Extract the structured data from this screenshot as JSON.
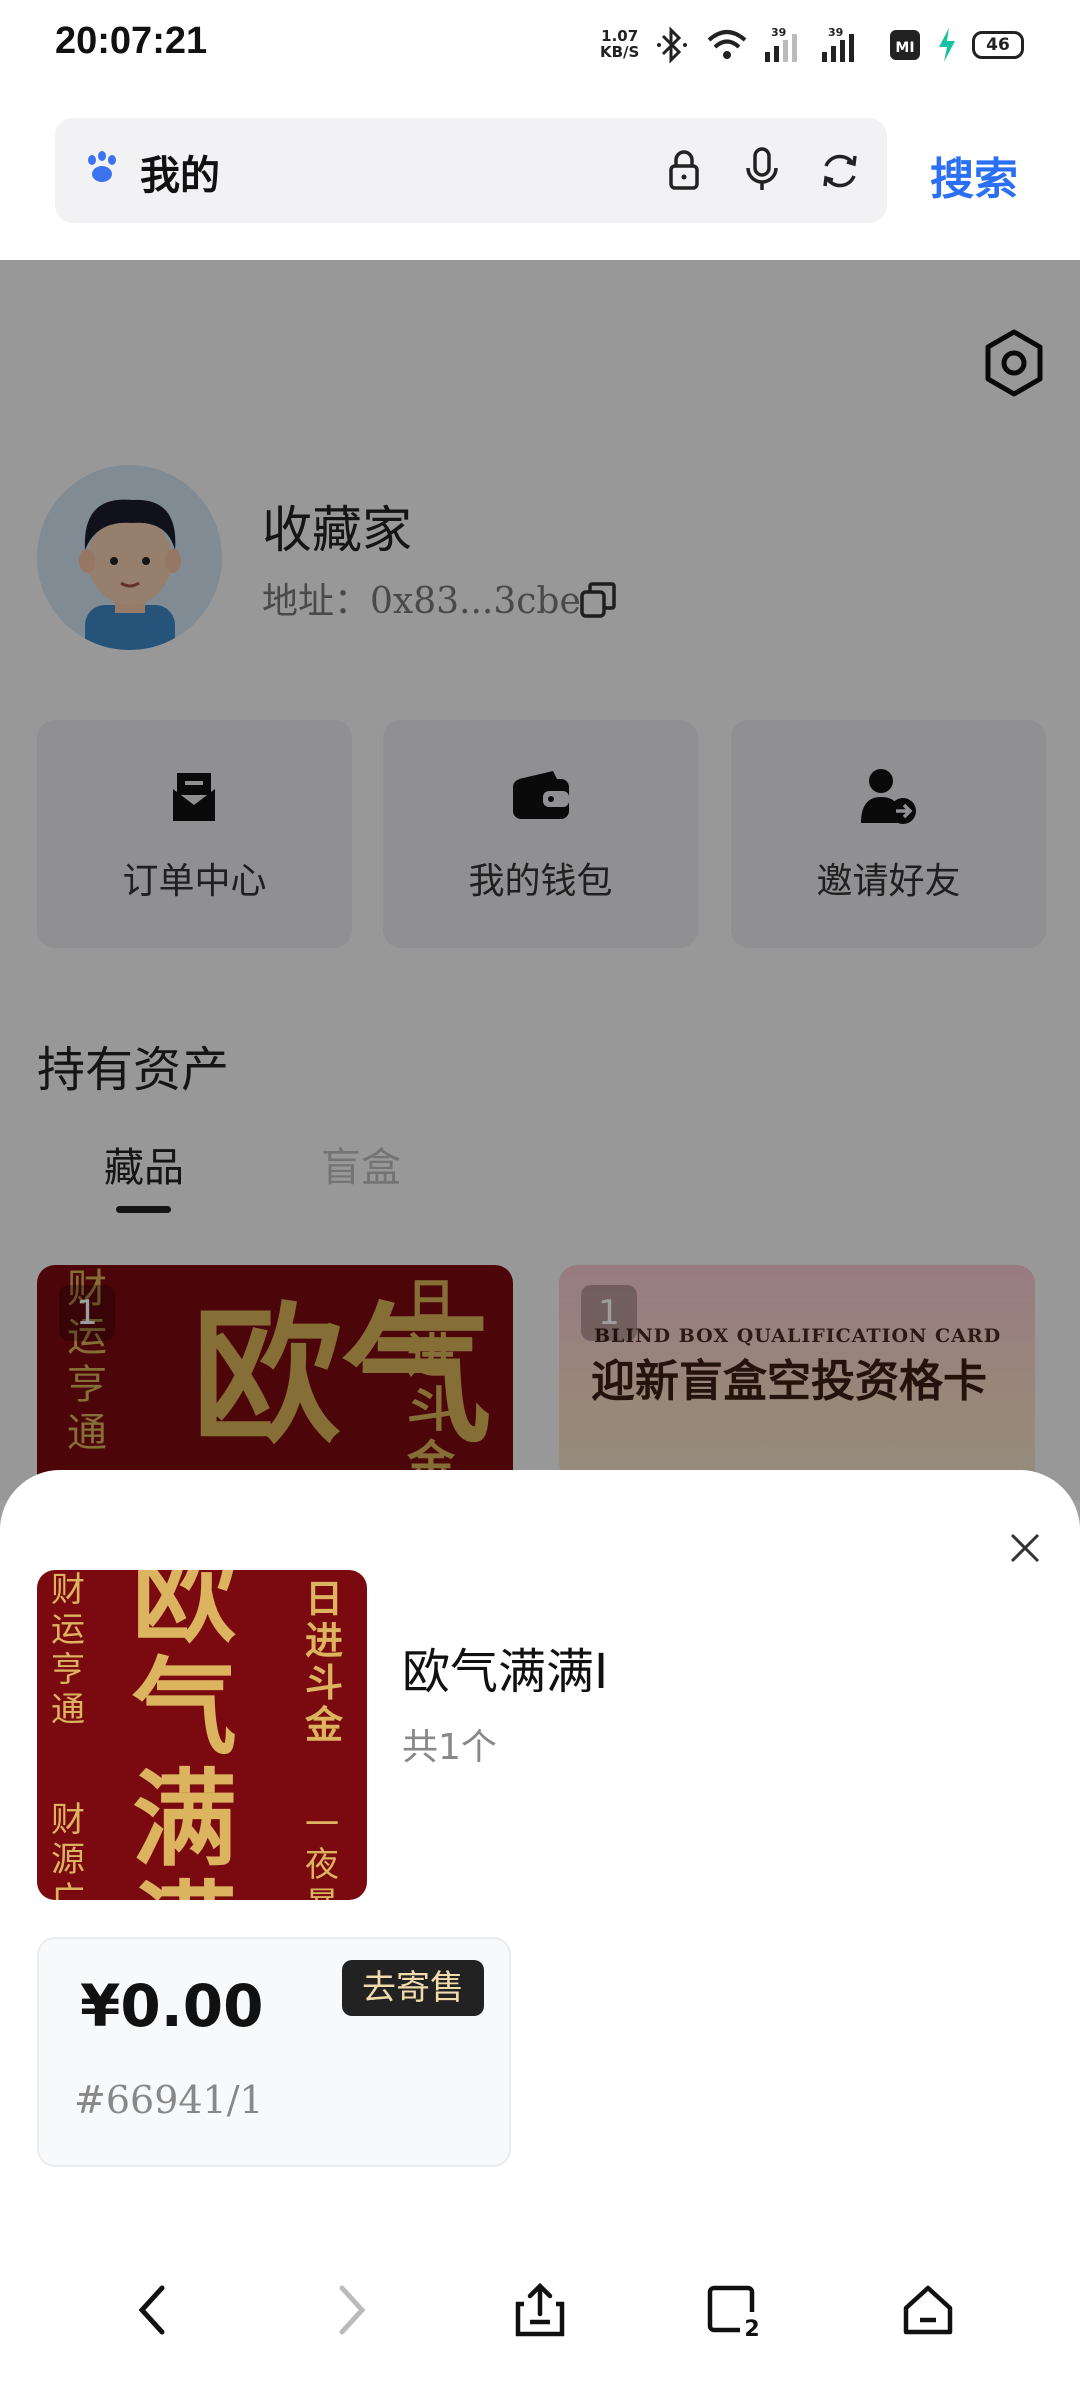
{
  "status_bar": {
    "time": "20:07:21",
    "net_speed_value": "1.07",
    "net_speed_unit": "KB/S",
    "signal1_label": "39",
    "signal2_label": "39",
    "battery": "46",
    "icons": [
      "bluetooth-icon",
      "wifi-icon",
      "signal-icon",
      "signal-icon",
      "nfc-icon",
      "charging-icon",
      "battery-icon"
    ]
  },
  "browser": {
    "search_text": "我的",
    "search_button": "搜索",
    "icons": [
      "paw-icon",
      "lock-icon",
      "microphone-icon",
      "refresh-icon"
    ]
  },
  "profile": {
    "name": "收藏家",
    "address": "地址：0x83...3cbe"
  },
  "quick_actions": [
    {
      "label": "订单中心",
      "icon": "order-icon"
    },
    {
      "label": "我的钱包",
      "icon": "wallet-icon"
    },
    {
      "label": "邀请好友",
      "icon": "invite-icon"
    }
  ],
  "assets": {
    "title": "持有资产",
    "tabs": [
      {
        "label": "藏品",
        "active": true
      },
      {
        "label": "盲盒",
        "active": false
      }
    ],
    "cards": [
      {
        "badge": "1",
        "art_text_main": "欧气",
        "art_text_side": "日进斗金",
        "art_text_left": "财运亨通"
      },
      {
        "badge": "1",
        "title": "迎新盲盒空投资格卡",
        "subtitle": "BLIND BOX QUALIFICATION CARD"
      }
    ]
  },
  "sheet": {
    "item_name": "欧气满满I",
    "count": "共1个",
    "price": "¥0.00",
    "consign_button": "去寄售",
    "serial": "#66941/1",
    "thumb_main": "欧气满满",
    "thumb_right_top": "日进斗金",
    "thumb_left_top": "财运亨通",
    "thumb_left_bottom": "财源广进",
    "thumb_right_bottom": "一夜暴富"
  },
  "colors": {
    "accent": "#2b6ff5",
    "dark_button": "#222222",
    "gold_text": "#f2dcae",
    "art_red": "#7b0a10"
  }
}
